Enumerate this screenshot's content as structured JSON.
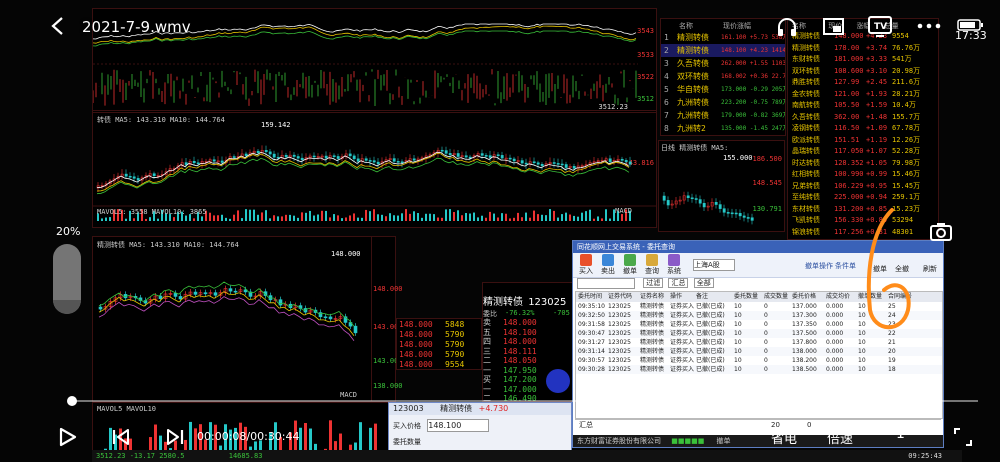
{
  "player": {
    "title": "2021-7-9.wmv",
    "time": "17:33",
    "volume_percent": 20,
    "volume_label": "20%",
    "elapsed": "00:00:08",
    "duration": "00:30:44",
    "time_display": "00:00:08/00:30:44",
    "progress_fraction": 0.0043,
    "power_saving_label": "省电",
    "speed_label": "倍速",
    "episode_label": "1"
  },
  "charts": {
    "top_vol_label": "3512.23",
    "top_right_values": [
      "3543",
      "3533",
      "3522",
      "3512"
    ],
    "mid_header": "转债 MA5: 143.310  MA10: 144.764",
    "mid_high": "159.142",
    "mid_right": "143.816",
    "mid_sub": "MAVOL5: 3558  MAVOL10: 3865",
    "mid_macd": "MACD",
    "mini_header": "日线 精测转债 MA5:",
    "mini_high": "155.000",
    "mini_values": [
      "186.500",
      "148.545",
      "130.791"
    ],
    "lower_header": "精测转债 MA5: 143.310  MA10: 144.764",
    "lower_high": "148.000",
    "lower_axis": [
      "148.000",
      "143.000",
      "143.000",
      "138.000"
    ],
    "lower_sub": "MAVOL5  MAVOL10",
    "lower_macd": "MACD"
  },
  "quote": {
    "name": "精测转债",
    "code": "123025",
    "change_label": "委比",
    "change_value": "-76.32%",
    "diff_value": "-705",
    "asks": [
      {
        "price": "148.000",
        "vol": "5848"
      },
      {
        "price": "148.000",
        "vol": "5790"
      },
      {
        "price": "148.000",
        "vol": "5790"
      },
      {
        "price": "148.000",
        "vol": "5790"
      },
      {
        "price": "148.000",
        "vol": "9554"
      }
    ],
    "levels": [
      "148.000",
      "148.100",
      "148.000",
      "148.111",
      "148.050",
      "147.950",
      "147.200",
      "147.000",
      "146.490"
    ],
    "level_labels": [
      "卖",
      "五",
      "四",
      "三",
      "二",
      "一",
      "买",
      "一",
      "二",
      "三"
    ]
  },
  "watchlist_a": {
    "headers": [
      "名称",
      "现价涨幅"
    ],
    "rows": [
      {
        "idx": "1",
        "name": "精测转债",
        "val": "161.100 +5.73 538万"
      },
      {
        "idx": "2",
        "name": "精测转债",
        "val": "148.100 +4.23 1414万"
      },
      {
        "idx": "3",
        "name": "久吾转债",
        "val": "262.000 +1.55 1103万"
      },
      {
        "idx": "4",
        "name": "双环转债",
        "val": "168.002 +0.36 22.7万"
      },
      {
        "idx": "5",
        "name": "华自转债",
        "val": "173.000 -0.29 205万"
      },
      {
        "idx": "6",
        "name": "九洲转债",
        "val": "223.200 -0.75 789万"
      },
      {
        "idx": "7",
        "name": "九洲转债",
        "val": "179.000 -0.82 369万"
      },
      {
        "idx": "8",
        "name": "九洲转2",
        "val": "135.000 -1.45 247万"
      }
    ]
  },
  "watchlist_b": {
    "headers": [
      "名称",
      "现价",
      "涨幅",
      "总量"
    ],
    "rows": [
      [
        "精测转债",
        "148.000",
        "+4.23",
        "9554"
      ],
      [
        "精测转债",
        "178.00",
        "+3.74",
        "76.76万"
      ],
      [
        "东财转债",
        "181.000",
        "+3.33",
        "541万"
      ],
      [
        "双环转债",
        "108.600",
        "+3.10",
        "20.98万"
      ],
      [
        "鼎胜转债",
        "127.99",
        "+2.45",
        "211.6万"
      ],
      [
        "金农转债",
        "121.00",
        "+1.93",
        "28.21万"
      ],
      [
        "南航转债",
        "105.50",
        "+1.59",
        "10.4万"
      ],
      [
        "久吾转债",
        "362.00",
        "+1.48",
        "155.7万"
      ],
      [
        "凌钢转债",
        "116.50",
        "+1.09",
        "67.78万"
      ],
      [
        "欧派转债",
        "151.51",
        "+1.19",
        "12.26万"
      ],
      [
        "晶瑞转债",
        "117.050",
        "+1.07",
        "52.28万"
      ],
      [
        "时达转债",
        "128.352",
        "+1.05",
        "79.98万"
      ],
      [
        "红相转债",
        "100.990",
        "+0.99",
        "15.46万"
      ],
      [
        "兄弟转债",
        "106.229",
        "+0.95",
        "15.45万"
      ],
      [
        "至纯转债",
        "225.000",
        "+0.94",
        "259.1万"
      ],
      [
        "东材转债",
        "131.200",
        "+0.85",
        "15.23万"
      ],
      [
        "飞凯转债",
        "156.330",
        "+0.84",
        "53294"
      ],
      [
        "锦浪转债",
        "117.256",
        "+0.81",
        "48301"
      ]
    ]
  },
  "trade_window": {
    "title": "同花顺网上交易系统 - 委托查询",
    "account": "上海A股",
    "toolbar": [
      "买入",
      "卖出",
      "撤单",
      "查询",
      "系统"
    ],
    "filters": [
      "过滤",
      "汇总",
      "全部"
    ],
    "right_tools": [
      "撤单",
      "全撤",
      "刷新"
    ],
    "right_links": [
      "撤单操作",
      "条件单"
    ],
    "columns": [
      "委托时间",
      "证券代码",
      "证券名称",
      "操作",
      "备注",
      "委托数量",
      "成交数量",
      "委托价格",
      "成交均价",
      "撤单数量",
      "合同编号"
    ],
    "rows": [
      [
        "09:35:10",
        "123025",
        "精测转债",
        "证券买入",
        "已撤(已成)",
        "10",
        "0",
        "137.000",
        "0.000",
        "10",
        "25"
      ],
      [
        "09:32:50",
        "123025",
        "精测转债",
        "证券买入",
        "已撤(已成)",
        "10",
        "0",
        "137.300",
        "0.000",
        "10",
        "24"
      ],
      [
        "09:31:58",
        "123025",
        "精测转债",
        "证券买入",
        "已撤(已成)",
        "10",
        "0",
        "137.350",
        "0.000",
        "10",
        "23"
      ],
      [
        "09:30:47",
        "123025",
        "精测转债",
        "证券买入",
        "已撤(已成)",
        "10",
        "0",
        "137.500",
        "0.000",
        "10",
        "22"
      ],
      [
        "09:31:27",
        "123025",
        "精测转债",
        "证券买入",
        "已撤(已成)",
        "10",
        "0",
        "137.800",
        "0.000",
        "10",
        "21"
      ],
      [
        "09:31:14",
        "123025",
        "精测转债",
        "证券买入",
        "已撤(已成)",
        "10",
        "0",
        "138.000",
        "0.000",
        "10",
        "20"
      ],
      [
        "09:30:57",
        "123025",
        "精测转债",
        "证券买入",
        "已撤(已成)",
        "10",
        "0",
        "138.200",
        "0.000",
        "10",
        "19"
      ],
      [
        "09:30:28",
        "123025",
        "精测转债",
        "证券买入",
        "已撤(已成)",
        "10",
        "0",
        "138.500",
        "0.000",
        "10",
        "18"
      ]
    ],
    "footer_left": "汇总",
    "footer_count": "20",
    "footer_count2": "0",
    "status": "东方财富证券股份有限公司",
    "status_right": "撤单"
  },
  "bottom_order": {
    "code": "123003",
    "name": "精测转债",
    "change": "+4.730",
    "price_label": "买入价格",
    "price_value": "148.100",
    "qty_label": "委托数量"
  },
  "status_bar": {
    "left": "3512.23  -13.17  2580.5",
    "mid": "14685.83",
    "time": "09:25:43"
  }
}
